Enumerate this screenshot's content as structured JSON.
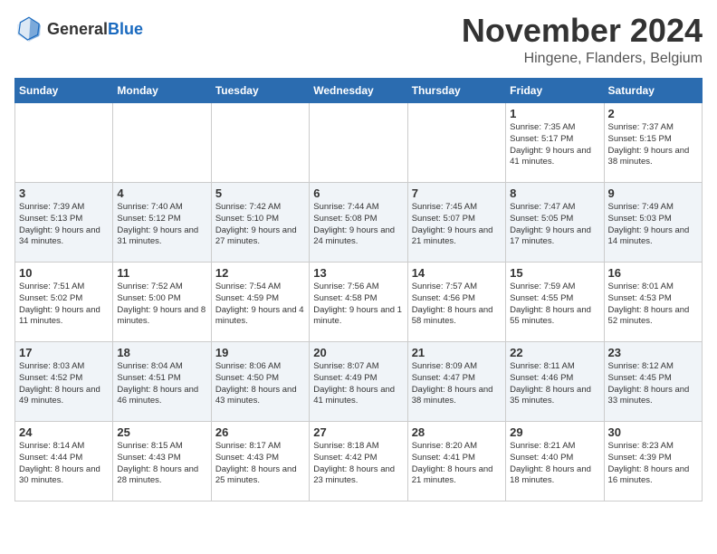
{
  "logo": {
    "general": "General",
    "blue": "Blue"
  },
  "header": {
    "month": "November 2024",
    "location": "Hingene, Flanders, Belgium"
  },
  "days_of_week": [
    "Sunday",
    "Monday",
    "Tuesday",
    "Wednesday",
    "Thursday",
    "Friday",
    "Saturday"
  ],
  "weeks": [
    [
      {
        "day": "",
        "info": ""
      },
      {
        "day": "",
        "info": ""
      },
      {
        "day": "",
        "info": ""
      },
      {
        "day": "",
        "info": ""
      },
      {
        "day": "",
        "info": ""
      },
      {
        "day": "1",
        "info": "Sunrise: 7:35 AM\nSunset: 5:17 PM\nDaylight: 9 hours and 41 minutes."
      },
      {
        "day": "2",
        "info": "Sunrise: 7:37 AM\nSunset: 5:15 PM\nDaylight: 9 hours and 38 minutes."
      }
    ],
    [
      {
        "day": "3",
        "info": "Sunrise: 7:39 AM\nSunset: 5:13 PM\nDaylight: 9 hours and 34 minutes."
      },
      {
        "day": "4",
        "info": "Sunrise: 7:40 AM\nSunset: 5:12 PM\nDaylight: 9 hours and 31 minutes."
      },
      {
        "day": "5",
        "info": "Sunrise: 7:42 AM\nSunset: 5:10 PM\nDaylight: 9 hours and 27 minutes."
      },
      {
        "day": "6",
        "info": "Sunrise: 7:44 AM\nSunset: 5:08 PM\nDaylight: 9 hours and 24 minutes."
      },
      {
        "day": "7",
        "info": "Sunrise: 7:45 AM\nSunset: 5:07 PM\nDaylight: 9 hours and 21 minutes."
      },
      {
        "day": "8",
        "info": "Sunrise: 7:47 AM\nSunset: 5:05 PM\nDaylight: 9 hours and 17 minutes."
      },
      {
        "day": "9",
        "info": "Sunrise: 7:49 AM\nSunset: 5:03 PM\nDaylight: 9 hours and 14 minutes."
      }
    ],
    [
      {
        "day": "10",
        "info": "Sunrise: 7:51 AM\nSunset: 5:02 PM\nDaylight: 9 hours and 11 minutes."
      },
      {
        "day": "11",
        "info": "Sunrise: 7:52 AM\nSunset: 5:00 PM\nDaylight: 9 hours and 8 minutes."
      },
      {
        "day": "12",
        "info": "Sunrise: 7:54 AM\nSunset: 4:59 PM\nDaylight: 9 hours and 4 minutes."
      },
      {
        "day": "13",
        "info": "Sunrise: 7:56 AM\nSunset: 4:58 PM\nDaylight: 9 hours and 1 minute."
      },
      {
        "day": "14",
        "info": "Sunrise: 7:57 AM\nSunset: 4:56 PM\nDaylight: 8 hours and 58 minutes."
      },
      {
        "day": "15",
        "info": "Sunrise: 7:59 AM\nSunset: 4:55 PM\nDaylight: 8 hours and 55 minutes."
      },
      {
        "day": "16",
        "info": "Sunrise: 8:01 AM\nSunset: 4:53 PM\nDaylight: 8 hours and 52 minutes."
      }
    ],
    [
      {
        "day": "17",
        "info": "Sunrise: 8:03 AM\nSunset: 4:52 PM\nDaylight: 8 hours and 49 minutes."
      },
      {
        "day": "18",
        "info": "Sunrise: 8:04 AM\nSunset: 4:51 PM\nDaylight: 8 hours and 46 minutes."
      },
      {
        "day": "19",
        "info": "Sunrise: 8:06 AM\nSunset: 4:50 PM\nDaylight: 8 hours and 43 minutes."
      },
      {
        "day": "20",
        "info": "Sunrise: 8:07 AM\nSunset: 4:49 PM\nDaylight: 8 hours and 41 minutes."
      },
      {
        "day": "21",
        "info": "Sunrise: 8:09 AM\nSunset: 4:47 PM\nDaylight: 8 hours and 38 minutes."
      },
      {
        "day": "22",
        "info": "Sunrise: 8:11 AM\nSunset: 4:46 PM\nDaylight: 8 hours and 35 minutes."
      },
      {
        "day": "23",
        "info": "Sunrise: 8:12 AM\nSunset: 4:45 PM\nDaylight: 8 hours and 33 minutes."
      }
    ],
    [
      {
        "day": "24",
        "info": "Sunrise: 8:14 AM\nSunset: 4:44 PM\nDaylight: 8 hours and 30 minutes."
      },
      {
        "day": "25",
        "info": "Sunrise: 8:15 AM\nSunset: 4:43 PM\nDaylight: 8 hours and 28 minutes."
      },
      {
        "day": "26",
        "info": "Sunrise: 8:17 AM\nSunset: 4:43 PM\nDaylight: 8 hours and 25 minutes."
      },
      {
        "day": "27",
        "info": "Sunrise: 8:18 AM\nSunset: 4:42 PM\nDaylight: 8 hours and 23 minutes."
      },
      {
        "day": "28",
        "info": "Sunrise: 8:20 AM\nSunset: 4:41 PM\nDaylight: 8 hours and 21 minutes."
      },
      {
        "day": "29",
        "info": "Sunrise: 8:21 AM\nSunset: 4:40 PM\nDaylight: 8 hours and 18 minutes."
      },
      {
        "day": "30",
        "info": "Sunrise: 8:23 AM\nSunset: 4:39 PM\nDaylight: 8 hours and 16 minutes."
      }
    ]
  ]
}
